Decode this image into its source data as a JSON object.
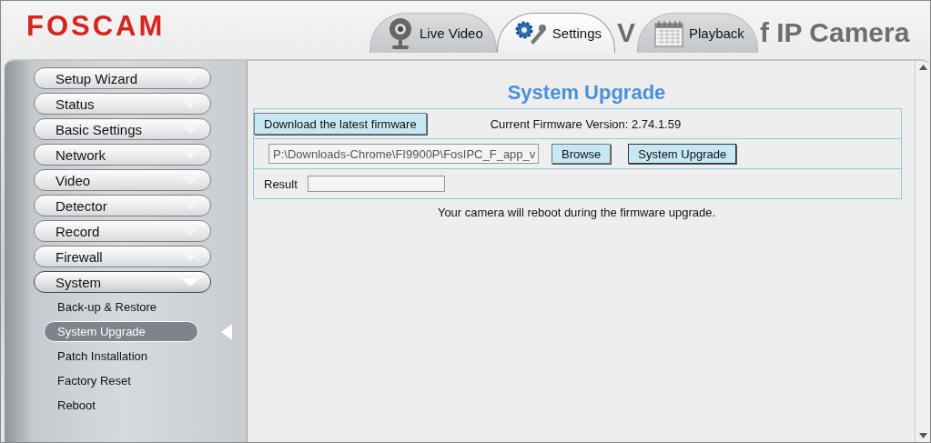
{
  "header": {
    "logo": "FOSCAM",
    "title_fragments": [
      "V",
      "f IP Camera"
    ]
  },
  "tabs": [
    {
      "label": "Live Video",
      "kind": "webcam",
      "selected": false
    },
    {
      "label": "Settings",
      "kind": "gears",
      "selected": true
    },
    {
      "label": "Playback",
      "kind": "calendar",
      "selected": false
    }
  ],
  "sidebar": {
    "items": [
      {
        "label": "Setup Wizard",
        "expanded": false
      },
      {
        "label": "Status",
        "expanded": false
      },
      {
        "label": "Basic Settings",
        "expanded": false
      },
      {
        "label": "Network",
        "expanded": false
      },
      {
        "label": "Video",
        "expanded": false
      },
      {
        "label": "Detector",
        "expanded": false
      },
      {
        "label": "Record",
        "expanded": false
      },
      {
        "label": "Firewall",
        "expanded": false
      },
      {
        "label": "System",
        "expanded": true,
        "children": [
          {
            "label": "Back-up & Restore",
            "selected": false
          },
          {
            "label": "System Upgrade",
            "selected": true
          },
          {
            "label": "Patch Installation",
            "selected": false
          },
          {
            "label": "Factory Reset",
            "selected": false
          },
          {
            "label": "Reboot",
            "selected": false
          }
        ]
      }
    ]
  },
  "content": {
    "title": "System Upgrade",
    "download_button": "Download the latest firmware",
    "firmware_version": "Current Firmware Version: 2.74.1.59",
    "file_field": {
      "value": "P:\\Downloads-Chrome\\FI9900P\\FosIPC_F_app_v"
    },
    "browse_button": "Browse",
    "upgrade_button": "System Upgrade",
    "result_label": "Result",
    "note": "Your camera will reboot during the firmware upgrade."
  }
}
